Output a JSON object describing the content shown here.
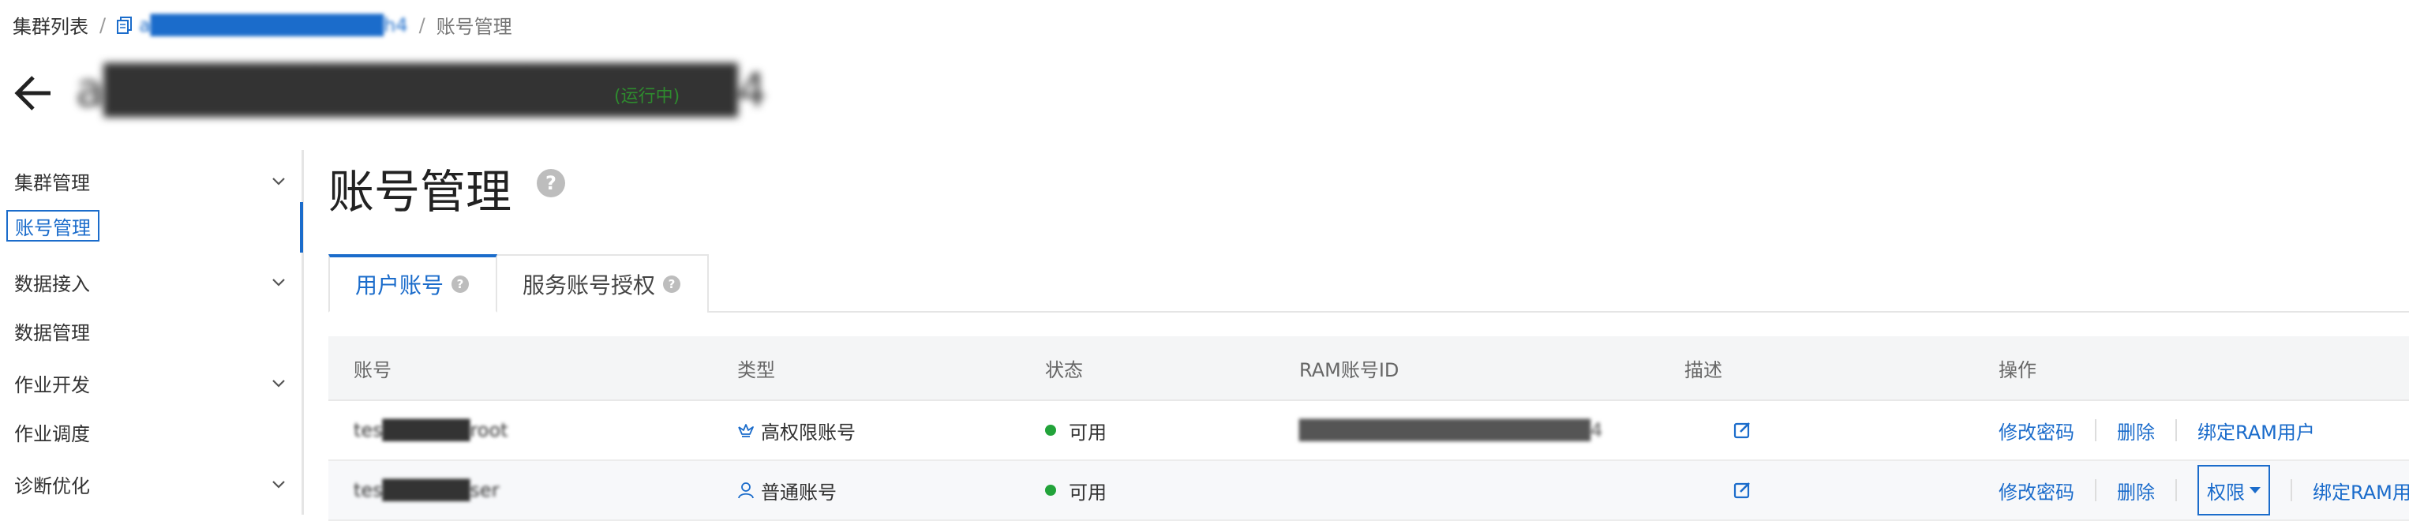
{
  "breadcrumb": {
    "root": "集群列表",
    "separator": "/",
    "cluster": "a████████████████h4",
    "current": "账号管理"
  },
  "header": {
    "cluster_name": "a██████████████████4",
    "status": "(运行中)"
  },
  "sidebar": {
    "items": [
      {
        "label": "集群管理",
        "expandable": true
      },
      {
        "label": "账号管理",
        "active": true
      },
      {
        "label": "数据接入",
        "expandable": true
      },
      {
        "label": "数据管理",
        "expandable": false
      },
      {
        "label": "作业开发",
        "expandable": true
      },
      {
        "label": "作业调度",
        "expandable": false
      },
      {
        "label": "诊断优化",
        "expandable": true
      }
    ]
  },
  "main": {
    "title": "账号管理",
    "help_glyph": "?",
    "tabs": [
      {
        "label": "用户账号",
        "active": true
      },
      {
        "label": "服务账号授权",
        "active": false
      }
    ],
    "table": {
      "columns": [
        "账号",
        "类型",
        "状态",
        "RAM账号ID",
        "描述",
        "操作"
      ],
      "rows": [
        {
          "account": "tes██████root",
          "type": "高权限账号",
          "type_icon": "crown-icon",
          "status": "可用",
          "ram_id": "████████████████████4",
          "actions": [
            "修改密码",
            "删除",
            "绑定RAM用户"
          ]
        },
        {
          "account": "tes██████ser",
          "type": "普通账号",
          "type_icon": "user-icon",
          "status": "可用",
          "ram_id": "",
          "actions": [
            "修改密码",
            "删除",
            "权限",
            "绑定RAM用户"
          ]
        }
      ]
    }
  },
  "colors": {
    "accent": "#1b6ccb",
    "status_green": "#22a33a",
    "running_green": "#2e8b2e"
  }
}
